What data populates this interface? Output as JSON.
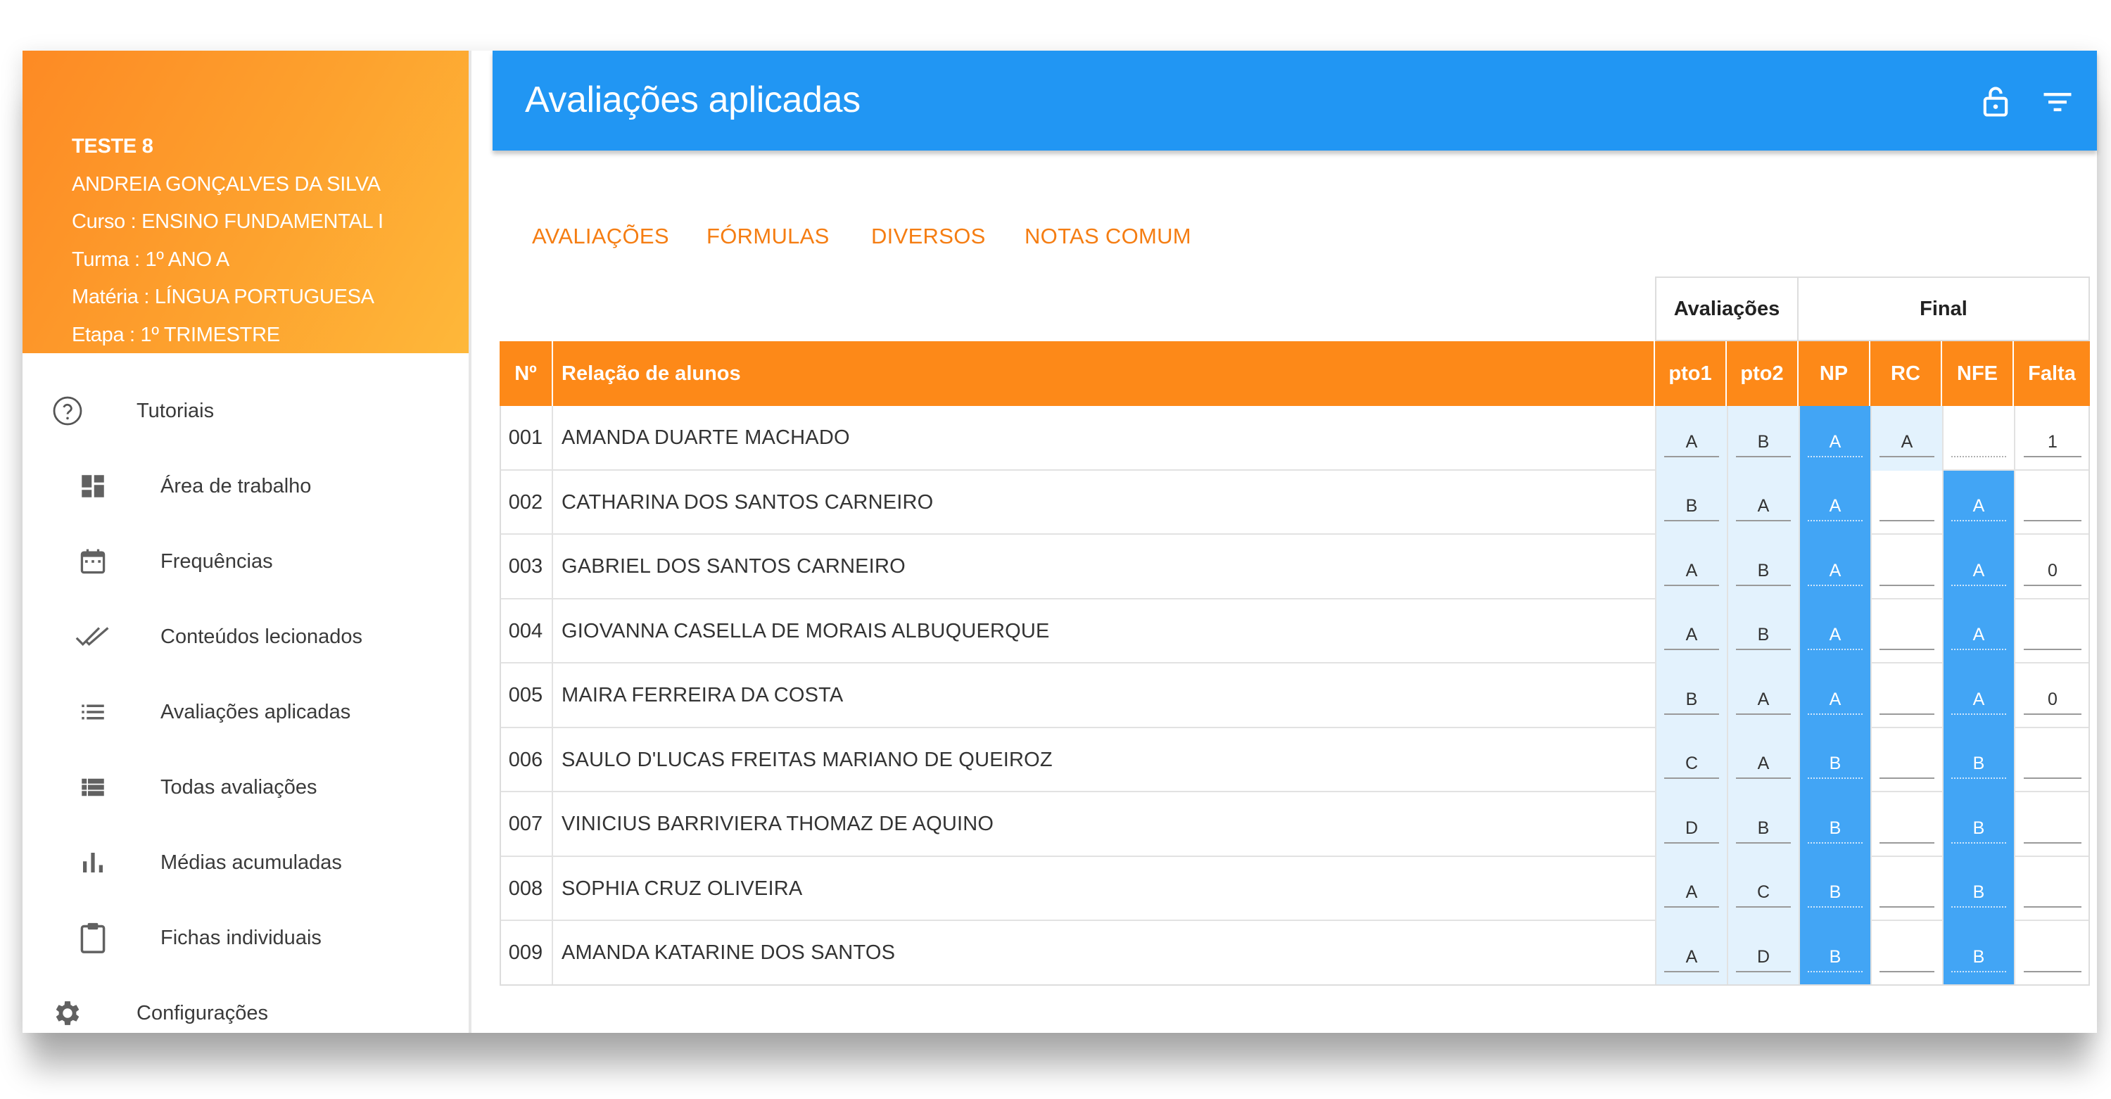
{
  "profile": {
    "lines": [
      "TESTE 8",
      "ANDREIA GONÇALVES DA SILVA",
      "Curso : ENSINO FUNDAMENTAL I",
      "Turma : 1º ANO A",
      "Matéria : LÍNGUA PORTUGUESA",
      "Etapa : 1º TRIMESTRE"
    ]
  },
  "menu": [
    {
      "label": "Tutoriais",
      "icon": "help-circle-icon"
    },
    {
      "label": "Área de trabalho",
      "icon": "dashboard-icon"
    },
    {
      "label": "Frequências",
      "icon": "calendar-icon"
    },
    {
      "label": "Conteúdos lecionados",
      "icon": "double-check-icon"
    },
    {
      "label": "Avaliações aplicadas",
      "icon": "list-icon"
    },
    {
      "label": "Todas avaliações",
      "icon": "view-list-icon"
    },
    {
      "label": "Médias acumuladas",
      "icon": "bar-chart-icon"
    },
    {
      "label": "Fichas individuais",
      "icon": "clipboard-icon"
    },
    {
      "label": "Configurações",
      "icon": "gear-icon"
    }
  ],
  "topbar": {
    "title": "Avaliações aplicadas",
    "icons": [
      "lock-open-icon",
      "filter-icon"
    ]
  },
  "tabs": [
    "AVALIAÇÕES",
    "FÓRMULAS",
    "DIVERSOS",
    "NOTAS COMUM"
  ],
  "table": {
    "group_headers": [
      "Avaliações",
      "Final"
    ],
    "columns": [
      "Nº",
      "Relação de alunos",
      "pto1",
      "pto2",
      "NP",
      "RC",
      "NFE",
      "Falta"
    ],
    "rows": [
      {
        "num": "001",
        "name": "AMANDA DUARTE MACHADO",
        "pto1": "A",
        "pto2": "B",
        "np": "A",
        "rc": "A",
        "nfe": "",
        "falta": "1"
      },
      {
        "num": "002",
        "name": "CATHARINA DOS SANTOS CARNEIRO",
        "pto1": "B",
        "pto2": "A",
        "np": "A",
        "rc": "",
        "nfe": "A",
        "falta": ""
      },
      {
        "num": "003",
        "name": "GABRIEL DOS SANTOS CARNEIRO",
        "pto1": "A",
        "pto2": "B",
        "np": "A",
        "rc": "",
        "nfe": "A",
        "falta": "0"
      },
      {
        "num": "004",
        "name": "GIOVANNA CASELLA DE MORAIS ALBUQUERQUE",
        "pto1": "A",
        "pto2": "B",
        "np": "A",
        "rc": "",
        "nfe": "A",
        "falta": ""
      },
      {
        "num": "005",
        "name": "MAIRA FERREIRA DA COSTA",
        "pto1": "B",
        "pto2": "A",
        "np": "A",
        "rc": "",
        "nfe": "A",
        "falta": "0"
      },
      {
        "num": "006",
        "name": "SAULO D'LUCAS FREITAS MARIANO DE QUEIROZ",
        "pto1": "C",
        "pto2": "A",
        "np": "B",
        "rc": "",
        "nfe": "B",
        "falta": ""
      },
      {
        "num": "007",
        "name": "VINICIUS BARRIVIERA THOMAZ DE AQUINO",
        "pto1": "D",
        "pto2": "B",
        "np": "B",
        "rc": "",
        "nfe": "B",
        "falta": ""
      },
      {
        "num": "008",
        "name": "SOPHIA CRUZ OLIVEIRA",
        "pto1": "A",
        "pto2": "C",
        "np": "B",
        "rc": "",
        "nfe": "B",
        "falta": ""
      },
      {
        "num": "009",
        "name": "AMANDA KATARINE DOS SANTOS",
        "pto1": "A",
        "pto2": "D",
        "np": "B",
        "rc": "",
        "nfe": "B",
        "falta": ""
      }
    ]
  },
  "colors": {
    "accent_blue": "#2196f3",
    "accent_orange": "#fd8918",
    "light_blue": "#e3f2fd",
    "mid_blue": "#42a5f5"
  }
}
